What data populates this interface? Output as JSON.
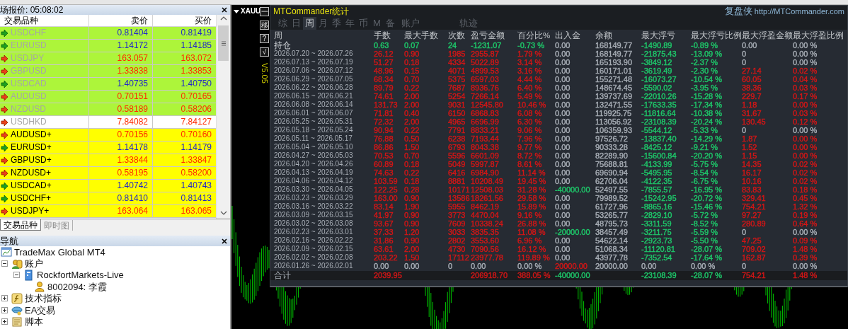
{
  "market_watch": {
    "title": "场报价: 05:08:02",
    "columns": [
      "交易品种",
      "卖价",
      "买价"
    ],
    "rows": [
      {
        "symbol": "USDCHF",
        "bid": "0.81404",
        "ask": "0.81419",
        "kind": "up",
        "disabled": true,
        "color": "#adf53a"
      },
      {
        "symbol": "EURUSD",
        "bid": "1.14172",
        "ask": "1.14185",
        "kind": "up",
        "disabled": true,
        "color": "#adf53a"
      },
      {
        "symbol": "USDJPY",
        "bid": "163.057",
        "ask": "163.072",
        "kind": "down",
        "disabled": true,
        "color": "#adf53a"
      },
      {
        "symbol": "GBPUSD",
        "bid": "1.33838",
        "ask": "1.33853",
        "kind": "down",
        "disabled": true,
        "color": "#adf53a"
      },
      {
        "symbol": "USDCAD",
        "bid": "1.40735",
        "ask": "1.40750",
        "kind": "up",
        "disabled": true,
        "color": "#adf53a"
      },
      {
        "symbol": "AUDUSD",
        "bid": "0.70151",
        "ask": "0.70165",
        "kind": "down",
        "disabled": true,
        "color": "#adf53a"
      },
      {
        "symbol": "NZDUSD",
        "bid": "0.58189",
        "ask": "0.58206",
        "kind": "down",
        "disabled": true,
        "color": "#adf53a"
      },
      {
        "symbol": "USDHKD",
        "bid": "7.84082",
        "ask": "7.84127",
        "kind": "down",
        "disabled": true,
        "color": "#ffffff"
      },
      {
        "symbol": "AUDUSD+",
        "bid": "0.70156",
        "ask": "0.70160",
        "kind": "down",
        "disabled": false,
        "color": "#ffff00"
      },
      {
        "symbol": "EURUSD+",
        "bid": "1.14178",
        "ask": "1.14179",
        "kind": "up",
        "disabled": false,
        "color": "#ffff00"
      },
      {
        "symbol": "GBPUSD+",
        "bid": "1.33844",
        "ask": "1.33847",
        "kind": "down",
        "disabled": false,
        "color": "#ffff00"
      },
      {
        "symbol": "NZDUSD+",
        "bid": "0.58195",
        "ask": "0.58200",
        "kind": "down",
        "disabled": false,
        "color": "#ffff00"
      },
      {
        "symbol": "USDCAD+",
        "bid": "1.40742",
        "ask": "1.40743",
        "kind": "up",
        "disabled": false,
        "color": "#ffff00"
      },
      {
        "symbol": "USDCHF+",
        "bid": "0.81410",
        "ask": "0.81413",
        "kind": "up",
        "disabled": false,
        "color": "#ffff00"
      },
      {
        "symbol": "USDJPY+",
        "bid": "163.064",
        "ask": "163.065",
        "kind": "down",
        "disabled": false,
        "color": "#ffff00"
      }
    ],
    "tabs": [
      {
        "label": "交易品种",
        "selected": true
      },
      {
        "label": "即时图",
        "selected": false
      }
    ]
  },
  "navigator": {
    "title": "导航",
    "tree": [
      {
        "label": "TradeMax Global MT4",
        "kind": "broker",
        "children": [
          {
            "label": "账户",
            "kind": "accounts",
            "expanded": true,
            "children": [
              {
                "label": "RockfortMarkets-Live",
                "kind": "server",
                "expanded": true,
                "children": [
                  {
                    "label": "8002094: 李霞",
                    "kind": "user"
                  }
                ]
              }
            ]
          },
          {
            "label": "技术指标",
            "kind": "indicators",
            "expanded": false
          },
          {
            "label": "EA交易",
            "kind": "experts",
            "expanded": false
          },
          {
            "label": "脚本",
            "kind": "scripts",
            "expanded": false
          }
        ]
      }
    ]
  },
  "chart": {
    "symbol": "XAUU",
    "buttons": [
      "一",
      "移",
      "?",
      "√"
    ],
    "version": "V5.05"
  },
  "stats": {
    "title": "MTCommander统计",
    "brand": "复盘侠",
    "link": "http://MTCommander.com",
    "tabs": [
      {
        "label": "综",
        "selected": false
      },
      {
        "label": "日",
        "selected": false
      },
      {
        "label": "周",
        "selected": true
      },
      {
        "label": "月",
        "selected": false
      },
      {
        "label": "季",
        "selected": false
      },
      {
        "label": "年",
        "selected": false
      },
      {
        "label": "币",
        "selected": false
      },
      {
        "label": "M",
        "selected": false
      },
      {
        "label": "备",
        "selected": false
      },
      {
        "label": "账户",
        "selected": false
      },
      {
        "label": "轨迹",
        "selected": false
      }
    ],
    "columns": [
      "周",
      "手数",
      "最大手数",
      "次数",
      "盈亏金额",
      "百分比%",
      "出入金",
      "余额",
      "最大浮亏",
      "最大浮亏比例",
      "最大浮盈金额",
      "最大浮盈比例"
    ],
    "rows": [
      {
        "kind": "position",
        "cells": [
          {
            "text": "持仓"
          },
          {
            "text": "0.63",
            "color": "#1ec86a"
          },
          {
            "text": "0.07",
            "color": "#1ec86a"
          },
          {
            "text": "24",
            "color": "#1ec86a"
          },
          {
            "text": "-1231.07",
            "color": "#1ec86a"
          },
          {
            "text": "-0.73 %",
            "color": "#1ec86a"
          },
          {
            "text": "0.00",
            "color": "#a8aeb6"
          },
          {
            "text": "168149.77",
            "color": "#a8aeb6"
          },
          {
            "text": "-1490.89",
            "color": "#1ec86a"
          },
          {
            "text": "-0.89 %",
            "color": "#1ec86a"
          },
          {
            "text": "0.00",
            "color": "#a8aeb6"
          },
          {
            "text": "0.00 %",
            "color": "#a8aeb6"
          }
        ]
      },
      {
        "kind": "week",
        "cells": [
          {
            "text": "2026.07.20 ~ 2026.07.26"
          },
          {
            "text": "26.12",
            "color": "#d41616"
          },
          {
            "text": "0.90",
            "color": "#d41616"
          },
          {
            "text": "1985",
            "color": "#d41616"
          },
          {
            "text": "2955.87",
            "color": "#d41616"
          },
          {
            "text": "1.79 %",
            "color": "#d41616"
          },
          {
            "text": "0.00",
            "color": "#a8aeb6"
          },
          {
            "text": "168149.77",
            "color": "#a8aeb6"
          },
          {
            "text": "-21875.43",
            "color": "#1ec86a"
          },
          {
            "text": "-13.09 %",
            "color": "#1ec86a"
          },
          {
            "text": "0",
            "color": "#a8aeb6"
          },
          {
            "text": "0.00 %",
            "color": "#a8aeb6"
          }
        ]
      },
      {
        "kind": "week",
        "cells": [
          {
            "text": "2026.07.13 ~ 2026.07.19"
          },
          {
            "text": "51.27",
            "color": "#d41616"
          },
          {
            "text": "0.18",
            "color": "#d41616"
          },
          {
            "text": "4334",
            "color": "#d41616"
          },
          {
            "text": "5022.89",
            "color": "#d41616"
          },
          {
            "text": "3.14 %",
            "color": "#d41616"
          },
          {
            "text": "0.00",
            "color": "#a8aeb6"
          },
          {
            "text": "165193.90",
            "color": "#a8aeb6"
          },
          {
            "text": "-3849.12",
            "color": "#1ec86a"
          },
          {
            "text": "-2.37 %",
            "color": "#1ec86a"
          },
          {
            "text": "0",
            "color": "#a8aeb6"
          },
          {
            "text": "0.00 %",
            "color": "#a8aeb6"
          }
        ]
      },
      {
        "kind": "week",
        "cells": [
          {
            "text": "2026.07.06 ~ 2026.07.12"
          },
          {
            "text": "48.96",
            "color": "#d41616"
          },
          {
            "text": "0.15",
            "color": "#d41616"
          },
          {
            "text": "4071",
            "color": "#d41616"
          },
          {
            "text": "4899.53",
            "color": "#d41616"
          },
          {
            "text": "3.16 %",
            "color": "#d41616"
          },
          {
            "text": "0.00",
            "color": "#a8aeb6"
          },
          {
            "text": "160171.01",
            "color": "#a8aeb6"
          },
          {
            "text": "-3619.49",
            "color": "#1ec86a"
          },
          {
            "text": "-2.30 %",
            "color": "#1ec86a"
          },
          {
            "text": "27.14",
            "color": "#d41616"
          },
          {
            "text": "0.02 %",
            "color": "#d41616"
          }
        ]
      },
      {
        "kind": "week",
        "cells": [
          {
            "text": "2026.06.29 ~ 2026.07.05"
          },
          {
            "text": "68.34",
            "color": "#d41616"
          },
          {
            "text": "0.70",
            "color": "#d41616"
          },
          {
            "text": "5375",
            "color": "#d41616"
          },
          {
            "text": "6597.03",
            "color": "#d41616"
          },
          {
            "text": "4.44 %",
            "color": "#d41616"
          },
          {
            "text": "0.00",
            "color": "#a8aeb6"
          },
          {
            "text": "155271.48",
            "color": "#a8aeb6"
          },
          {
            "text": "-16073.27",
            "color": "#1ec86a"
          },
          {
            "text": "-10.54 %",
            "color": "#1ec86a"
          },
          {
            "text": "60.05",
            "color": "#d41616"
          },
          {
            "text": "0.04 %",
            "color": "#d41616"
          }
        ]
      },
      {
        "kind": "week",
        "cells": [
          {
            "text": "2026.06.22 ~ 2026.06.28"
          },
          {
            "text": "89.79",
            "color": "#d41616"
          },
          {
            "text": "0.22",
            "color": "#d41616"
          },
          {
            "text": "7687",
            "color": "#d41616"
          },
          {
            "text": "8936.76",
            "color": "#d41616"
          },
          {
            "text": "6.40 %",
            "color": "#d41616"
          },
          {
            "text": "0.00",
            "color": "#a8aeb6"
          },
          {
            "text": "148674.45",
            "color": "#a8aeb6"
          },
          {
            "text": "-5590.02",
            "color": "#1ec86a"
          },
          {
            "text": "-3.95 %",
            "color": "#1ec86a"
          },
          {
            "text": "38.36",
            "color": "#d41616"
          },
          {
            "text": "0.03 %",
            "color": "#d41616"
          }
        ]
      },
      {
        "kind": "week",
        "cells": [
          {
            "text": "2026.06.15 ~ 2026.06.21"
          },
          {
            "text": "74.61",
            "color": "#d41616"
          },
          {
            "text": "2.00",
            "color": "#d41616"
          },
          {
            "text": "5254",
            "color": "#d41616"
          },
          {
            "text": "7266.14",
            "color": "#d41616"
          },
          {
            "text": "5.49 %",
            "color": "#d41616"
          },
          {
            "text": "0.00",
            "color": "#a8aeb6"
          },
          {
            "text": "139737.69",
            "color": "#a8aeb6"
          },
          {
            "text": "-22010.26",
            "color": "#1ec86a"
          },
          {
            "text": "-15.28 %",
            "color": "#1ec86a"
          },
          {
            "text": "229.7",
            "color": "#d41616"
          },
          {
            "text": "0.17 %",
            "color": "#d41616"
          }
        ]
      },
      {
        "kind": "week",
        "cells": [
          {
            "text": "2026.06.08 ~ 2026.06.14"
          },
          {
            "text": "131.73",
            "color": "#d41616"
          },
          {
            "text": "2.00",
            "color": "#d41616"
          },
          {
            "text": "9031",
            "color": "#d41616"
          },
          {
            "text": "12545.80",
            "color": "#d41616"
          },
          {
            "text": "10.46 %",
            "color": "#d41616"
          },
          {
            "text": "0.00",
            "color": "#a8aeb6"
          },
          {
            "text": "132471.55",
            "color": "#a8aeb6"
          },
          {
            "text": "-17633.35",
            "color": "#1ec86a"
          },
          {
            "text": "-17.34 %",
            "color": "#1ec86a"
          },
          {
            "text": "1.18",
            "color": "#d41616"
          },
          {
            "text": "0.00 %",
            "color": "#d41616"
          }
        ]
      },
      {
        "kind": "week",
        "cells": [
          {
            "text": "2026.06.01 ~ 2026.06.07"
          },
          {
            "text": "71.81",
            "color": "#d41616"
          },
          {
            "text": "0.40",
            "color": "#d41616"
          },
          {
            "text": "6150",
            "color": "#d41616"
          },
          {
            "text": "6868.83",
            "color": "#d41616"
          },
          {
            "text": "6.08 %",
            "color": "#d41616"
          },
          {
            "text": "0.00",
            "color": "#a8aeb6"
          },
          {
            "text": "119925.75",
            "color": "#a8aeb6"
          },
          {
            "text": "-11816.64",
            "color": "#1ec86a"
          },
          {
            "text": "-10.38 %",
            "color": "#1ec86a"
          },
          {
            "text": "31.67",
            "color": "#d41616"
          },
          {
            "text": "0.03 %",
            "color": "#d41616"
          }
        ]
      },
      {
        "kind": "week",
        "cells": [
          {
            "text": "2026.05.25 ~ 2026.05.31"
          },
          {
            "text": "72.32",
            "color": "#d41616"
          },
          {
            "text": "2.00",
            "color": "#d41616"
          },
          {
            "text": "4965",
            "color": "#d41616"
          },
          {
            "text": "6696.99",
            "color": "#d41616"
          },
          {
            "text": "6.30 %",
            "color": "#d41616"
          },
          {
            "text": "0.00",
            "color": "#a8aeb6"
          },
          {
            "text": "113056.92",
            "color": "#a8aeb6"
          },
          {
            "text": "-23108.39",
            "color": "#1ec86a"
          },
          {
            "text": "-20.24 %",
            "color": "#1ec86a"
          },
          {
            "text": "130.45",
            "color": "#d41616"
          },
          {
            "text": "0.12 %",
            "color": "#d41616"
          }
        ]
      },
      {
        "kind": "week",
        "cells": [
          {
            "text": "2026.05.18 ~ 2026.05.24"
          },
          {
            "text": "90.94",
            "color": "#d41616"
          },
          {
            "text": "0.22",
            "color": "#d41616"
          },
          {
            "text": "7791",
            "color": "#d41616"
          },
          {
            "text": "8833.21",
            "color": "#d41616"
          },
          {
            "text": "9.06 %",
            "color": "#d41616"
          },
          {
            "text": "0.00",
            "color": "#a8aeb6"
          },
          {
            "text": "106359.93",
            "color": "#a8aeb6"
          },
          {
            "text": "-5544.12",
            "color": "#1ec86a"
          },
          {
            "text": "-5.33 %",
            "color": "#1ec86a"
          },
          {
            "text": "0",
            "color": "#a8aeb6"
          },
          {
            "text": "0.00 %",
            "color": "#a8aeb6"
          }
        ]
      },
      {
        "kind": "week",
        "cells": [
          {
            "text": "2026.05.11 ~ 2026.05.17"
          },
          {
            "text": "76.88",
            "color": "#d41616"
          },
          {
            "text": "0.50",
            "color": "#d41616"
          },
          {
            "text": "6238",
            "color": "#d41616"
          },
          {
            "text": "7193.44",
            "color": "#d41616"
          },
          {
            "text": "7.96 %",
            "color": "#d41616"
          },
          {
            "text": "0.00",
            "color": "#a8aeb6"
          },
          {
            "text": "97526.72",
            "color": "#a8aeb6"
          },
          {
            "text": "-13837.40",
            "color": "#1ec86a"
          },
          {
            "text": "-14.29 %",
            "color": "#1ec86a"
          },
          {
            "text": "1.87",
            "color": "#d41616"
          },
          {
            "text": "0.00 %",
            "color": "#d41616"
          }
        ]
      },
      {
        "kind": "week",
        "cells": [
          {
            "text": "2026.05.04 ~ 2026.05.10"
          },
          {
            "text": "86.86",
            "color": "#d41616"
          },
          {
            "text": "1.50",
            "color": "#d41616"
          },
          {
            "text": "6793",
            "color": "#d41616"
          },
          {
            "text": "8043.38",
            "color": "#d41616"
          },
          {
            "text": "9.77 %",
            "color": "#d41616"
          },
          {
            "text": "0.00",
            "color": "#a8aeb6"
          },
          {
            "text": "90333.28",
            "color": "#a8aeb6"
          },
          {
            "text": "-8425.12",
            "color": "#1ec86a"
          },
          {
            "text": "-9.21 %",
            "color": "#1ec86a"
          },
          {
            "text": "1.52",
            "color": "#d41616"
          },
          {
            "text": "0.00 %",
            "color": "#d41616"
          }
        ]
      },
      {
        "kind": "week",
        "cells": [
          {
            "text": "2026.04.27 ~ 2026.05.03"
          },
          {
            "text": "70.53",
            "color": "#d41616"
          },
          {
            "text": "0.70",
            "color": "#d41616"
          },
          {
            "text": "5596",
            "color": "#d41616"
          },
          {
            "text": "6601.09",
            "color": "#d41616"
          },
          {
            "text": "8.72 %",
            "color": "#d41616"
          },
          {
            "text": "0.00",
            "color": "#a8aeb6"
          },
          {
            "text": "82289.90",
            "color": "#a8aeb6"
          },
          {
            "text": "-15600.84",
            "color": "#1ec86a"
          },
          {
            "text": "-20.20 %",
            "color": "#1ec86a"
          },
          {
            "text": "1.15",
            "color": "#d41616"
          },
          {
            "text": "0.00 %",
            "color": "#d41616"
          }
        ]
      },
      {
        "kind": "week",
        "cells": [
          {
            "text": "2026.04.20 ~ 2026.04.26"
          },
          {
            "text": "60.89",
            "color": "#d41616"
          },
          {
            "text": "0.18",
            "color": "#d41616"
          },
          {
            "text": "5049",
            "color": "#d41616"
          },
          {
            "text": "5997.87",
            "color": "#d41616"
          },
          {
            "text": "8.61 %",
            "color": "#d41616"
          },
          {
            "text": "0.00",
            "color": "#a8aeb6"
          },
          {
            "text": "75688.81",
            "color": "#a8aeb6"
          },
          {
            "text": "-4133.99",
            "color": "#1ec86a"
          },
          {
            "text": "-5.75 %",
            "color": "#1ec86a"
          },
          {
            "text": "14.35",
            "color": "#d41616"
          },
          {
            "text": "0.02 %",
            "color": "#d41616"
          }
        ]
      },
      {
        "kind": "week",
        "cells": [
          {
            "text": "2026.04.13 ~ 2026.04.19"
          },
          {
            "text": "74.63",
            "color": "#d41616"
          },
          {
            "text": "0.22",
            "color": "#d41616"
          },
          {
            "text": "6416",
            "color": "#d41616"
          },
          {
            "text": "6984.90",
            "color": "#d41616"
          },
          {
            "text": "11.14 %",
            "color": "#d41616"
          },
          {
            "text": "0.00",
            "color": "#a8aeb6"
          },
          {
            "text": "69690.94",
            "color": "#a8aeb6"
          },
          {
            "text": "-5495.95",
            "color": "#1ec86a"
          },
          {
            "text": "-8.54 %",
            "color": "#1ec86a"
          },
          {
            "text": "16.17",
            "color": "#d41616"
          },
          {
            "text": "0.02 %",
            "color": "#d41616"
          }
        ]
      },
      {
        "kind": "week",
        "cells": [
          {
            "text": "2026.04.06 ~ 2026.04.12"
          },
          {
            "text": "103.59",
            "color": "#d41616"
          },
          {
            "text": "0.18",
            "color": "#d41616"
          },
          {
            "text": "8881",
            "color": "#d41616"
          },
          {
            "text": "10208.49",
            "color": "#d41616"
          },
          {
            "text": "19.45 %",
            "color": "#d41616"
          },
          {
            "text": "0.00",
            "color": "#a8aeb6"
          },
          {
            "text": "62706.04",
            "color": "#a8aeb6"
          },
          {
            "text": "-4122.35",
            "color": "#1ec86a"
          },
          {
            "text": "-6.75 %",
            "color": "#1ec86a"
          },
          {
            "text": "10.16",
            "color": "#d41616"
          },
          {
            "text": "0.02 %",
            "color": "#d41616"
          }
        ]
      },
      {
        "kind": "week",
        "cells": [
          {
            "text": "2026.03.30 ~ 2026.04.05"
          },
          {
            "text": "122.25",
            "color": "#d41616"
          },
          {
            "text": "0.28",
            "color": "#d41616"
          },
          {
            "text": "10171",
            "color": "#d41616"
          },
          {
            "text": "12508.03",
            "color": "#d41616"
          },
          {
            "text": "31.28 %",
            "color": "#d41616"
          },
          {
            "text": "-40000.00",
            "color": "#1ec86a"
          },
          {
            "text": "52497.55",
            "color": "#a8aeb6"
          },
          {
            "text": "-7855.57",
            "color": "#1ec86a"
          },
          {
            "text": "-16.95 %",
            "color": "#1ec86a"
          },
          {
            "text": "83.83",
            "color": "#d41616"
          },
          {
            "text": "0.18 %",
            "color": "#d41616"
          }
        ]
      },
      {
        "kind": "week",
        "cells": [
          {
            "text": "2026.03.23 ~ 2026.03.29"
          },
          {
            "text": "163.00",
            "color": "#d41616"
          },
          {
            "text": "0.90",
            "color": "#d41616"
          },
          {
            "text": "13586",
            "color": "#d41616"
          },
          {
            "text": "18261.56",
            "color": "#d41616"
          },
          {
            "text": "29.58 %",
            "color": "#d41616"
          },
          {
            "text": "0.00",
            "color": "#a8aeb6"
          },
          {
            "text": "79989.52",
            "color": "#a8aeb6"
          },
          {
            "text": "-15242.95",
            "color": "#1ec86a"
          },
          {
            "text": "-20.72 %",
            "color": "#1ec86a"
          },
          {
            "text": "329.41",
            "color": "#d41616"
          },
          {
            "text": "0.45 %",
            "color": "#d41616"
          }
        ]
      },
      {
        "kind": "week",
        "cells": [
          {
            "text": "2026.03.16 ~ 2026.03.22"
          },
          {
            "text": "83.14",
            "color": "#d41616"
          },
          {
            "text": "1.90",
            "color": "#d41616"
          },
          {
            "text": "5955",
            "color": "#d41616"
          },
          {
            "text": "8462.19",
            "color": "#d41616"
          },
          {
            "text": "15.89 %",
            "color": "#d41616"
          },
          {
            "text": "0.00",
            "color": "#a8aeb6"
          },
          {
            "text": "61727.96",
            "color": "#a8aeb6"
          },
          {
            "text": "-8865.16",
            "color": "#1ec86a"
          },
          {
            "text": "-15.46 %",
            "color": "#1ec86a"
          },
          {
            "text": "754.21",
            "color": "#d41616"
          },
          {
            "text": "1.32 %",
            "color": "#d41616"
          }
        ]
      },
      {
        "kind": "week",
        "cells": [
          {
            "text": "2026.03.09 ~ 2026.03.15"
          },
          {
            "text": "41.97",
            "color": "#d41616"
          },
          {
            "text": "0.90",
            "color": "#d41616"
          },
          {
            "text": "3773",
            "color": "#d41616"
          },
          {
            "text": "4470.04",
            "color": "#d41616"
          },
          {
            "text": "9.16 %",
            "color": "#d41616"
          },
          {
            "text": "0.00",
            "color": "#a8aeb6"
          },
          {
            "text": "53265.77",
            "color": "#a8aeb6"
          },
          {
            "text": "-2829.10",
            "color": "#1ec86a"
          },
          {
            "text": "-5.72 %",
            "color": "#1ec86a"
          },
          {
            "text": "97.27",
            "color": "#d41616"
          },
          {
            "text": "0.19 %",
            "color": "#d41616"
          }
        ]
      },
      {
        "kind": "week",
        "cells": [
          {
            "text": "2026.03.02 ~ 2026.03.08"
          },
          {
            "text": "93.67",
            "color": "#d41616"
          },
          {
            "text": "0.90",
            "color": "#d41616"
          },
          {
            "text": "7609",
            "color": "#d41616"
          },
          {
            "text": "10338.24",
            "color": "#d41616"
          },
          {
            "text": "26.88 %",
            "color": "#d41616"
          },
          {
            "text": "0.00",
            "color": "#a8aeb6"
          },
          {
            "text": "48795.73",
            "color": "#a8aeb6"
          },
          {
            "text": "-3311.59",
            "color": "#1ec86a"
          },
          {
            "text": "-8.52 %",
            "color": "#1ec86a"
          },
          {
            "text": "280.89",
            "color": "#d41616"
          },
          {
            "text": "0.64 %",
            "color": "#d41616"
          }
        ]
      },
      {
        "kind": "week",
        "cells": [
          {
            "text": "2026.02.23 ~ 2026.03.01"
          },
          {
            "text": "37.33",
            "color": "#d41616"
          },
          {
            "text": "1.20",
            "color": "#d41616"
          },
          {
            "text": "3033",
            "color": "#d41616"
          },
          {
            "text": "3835.35",
            "color": "#d41616"
          },
          {
            "text": "11.08 %",
            "color": "#d41616"
          },
          {
            "text": "-20000.00",
            "color": "#1ec86a"
          },
          {
            "text": "38457.49",
            "color": "#a8aeb6"
          },
          {
            "text": "-3211.75",
            "color": "#1ec86a"
          },
          {
            "text": "-5.59 %",
            "color": "#1ec86a"
          },
          {
            "text": "0",
            "color": "#a8aeb6"
          },
          {
            "text": "0.00 %",
            "color": "#a8aeb6"
          }
        ]
      },
      {
        "kind": "week",
        "cells": [
          {
            "text": "2026.02.16 ~ 2026.02.22"
          },
          {
            "text": "31.86",
            "color": "#d41616"
          },
          {
            "text": "0.90",
            "color": "#d41616"
          },
          {
            "text": "2802",
            "color": "#d41616"
          },
          {
            "text": "3553.60",
            "color": "#d41616"
          },
          {
            "text": "6.96 %",
            "color": "#d41616"
          },
          {
            "text": "0.00",
            "color": "#a8aeb6"
          },
          {
            "text": "54622.14",
            "color": "#a8aeb6"
          },
          {
            "text": "-2923.73",
            "color": "#1ec86a"
          },
          {
            "text": "-5.50 %",
            "color": "#1ec86a"
          },
          {
            "text": "47.25",
            "color": "#d41616"
          },
          {
            "text": "0.09 %",
            "color": "#d41616"
          }
        ]
      },
      {
        "kind": "week",
        "cells": [
          {
            "text": "2026.02.09 ~ 2026.02.15"
          },
          {
            "text": "63.61",
            "color": "#d41616"
          },
          {
            "text": "2.00",
            "color": "#d41616"
          },
          {
            "text": "4730",
            "color": "#d41616"
          },
          {
            "text": "7090.56",
            "color": "#d41616"
          },
          {
            "text": "16.12 %",
            "color": "#d41616"
          },
          {
            "text": "0.00",
            "color": "#a8aeb6"
          },
          {
            "text": "51068.34",
            "color": "#a8aeb6"
          },
          {
            "text": "-11120.81",
            "color": "#1ec86a"
          },
          {
            "text": "-28.07 %",
            "color": "#1ec86a"
          },
          {
            "text": "709.02",
            "color": "#d41616"
          },
          {
            "text": "1.48 %",
            "color": "#d41616"
          }
        ]
      },
      {
        "kind": "week",
        "cells": [
          {
            "text": "2026.02.02 ~ 2026.02.08"
          },
          {
            "text": "203.22",
            "color": "#d41616"
          },
          {
            "text": "1.50",
            "color": "#d41616"
          },
          {
            "text": "17112",
            "color": "#d41616"
          },
          {
            "text": "23977.78",
            "color": "#d41616"
          },
          {
            "text": "119.89 %",
            "color": "#d41616"
          },
          {
            "text": "0.00",
            "color": "#a8aeb6"
          },
          {
            "text": "43977.78",
            "color": "#a8aeb6"
          },
          {
            "text": "-7352.54",
            "color": "#1ec86a"
          },
          {
            "text": "-17.64 %",
            "color": "#1ec86a"
          },
          {
            "text": "162.87",
            "color": "#d41616"
          },
          {
            "text": "0.39 %",
            "color": "#d41616"
          }
        ]
      },
      {
        "kind": "week",
        "cells": [
          {
            "text": "2026.01.26 ~ 2026.02.01"
          },
          {
            "text": "0.00",
            "color": "#a8aeb6"
          },
          {
            "text": "0.00",
            "color": "#a8aeb6"
          },
          {
            "text": "0",
            "color": "#a8aeb6"
          },
          {
            "text": "0.00",
            "color": "#a8aeb6"
          },
          {
            "text": "0.00 %",
            "color": "#a8aeb6"
          },
          {
            "text": "20000.00",
            "color": "#d41616"
          },
          {
            "text": "20000.00",
            "color": "#a8aeb6"
          },
          {
            "text": "0.00",
            "color": "#a8aeb6"
          },
          {
            "text": "0.00 %",
            "color": "#a8aeb6"
          },
          {
            "text": "0",
            "color": "#a8aeb6"
          },
          {
            "text": "0.00 %",
            "color": "#a8aeb6"
          }
        ]
      },
      {
        "kind": "total",
        "cells": [
          {
            "text": "合计"
          },
          {
            "text": "2039.95",
            "color": "#d41616"
          },
          {
            "text": ""
          },
          {
            "text": ""
          },
          {
            "text": "206918.70",
            "color": "#d41616"
          },
          {
            "text": "388.05 %",
            "color": "#d41616"
          },
          {
            "text": "-40000.00",
            "color": "#1ec86a"
          },
          {
            "text": ""
          },
          {
            "text": "-23108.39",
            "color": "#1ec86a"
          },
          {
            "text": "-28.07 %",
            "color": "#1ec86a"
          },
          {
            "text": "754.21",
            "color": "#d41616"
          },
          {
            "text": "1.48 %",
            "color": "#d41616"
          }
        ]
      }
    ]
  }
}
